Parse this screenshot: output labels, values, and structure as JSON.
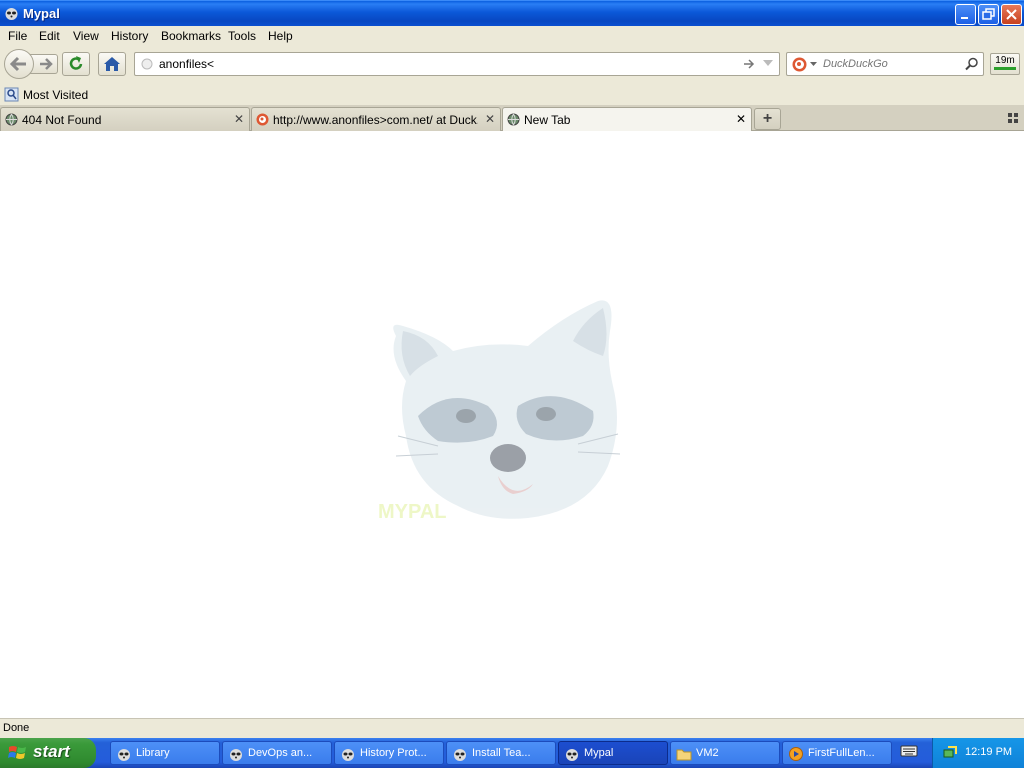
{
  "window": {
    "title": "Mypal"
  },
  "menu": [
    "File",
    "Edit",
    "View",
    "History",
    "Bookmarks",
    "Tools",
    "Help"
  ],
  "address": {
    "value": "anonfiles<"
  },
  "search": {
    "engine": "DuckDuckGo"
  },
  "timer_label": "19m",
  "bookmarks": {
    "most_visited": "Most Visited"
  },
  "tabs": [
    {
      "label": "404 Not Found"
    },
    {
      "label": "http://www.anonfiles>com.net/ at Duck..."
    },
    {
      "label": "New Tab"
    }
  ],
  "mascot_caption": "MYPAL",
  "status": "Done",
  "taskbar": {
    "start": "start",
    "items": [
      {
        "label": "Library"
      },
      {
        "label": "DevOps an..."
      },
      {
        "label": "History Prot..."
      },
      {
        "label": "Install Tea..."
      },
      {
        "label": "Mypal"
      },
      {
        "label": "VM2"
      },
      {
        "label": "FirstFullLen..."
      }
    ],
    "clock": "12:19 PM"
  },
  "colors": {
    "titlebar": "#0a4fd0",
    "taskbar": "#245cdb",
    "start": "#3a9a3a",
    "chrome": "#ece9d8"
  }
}
